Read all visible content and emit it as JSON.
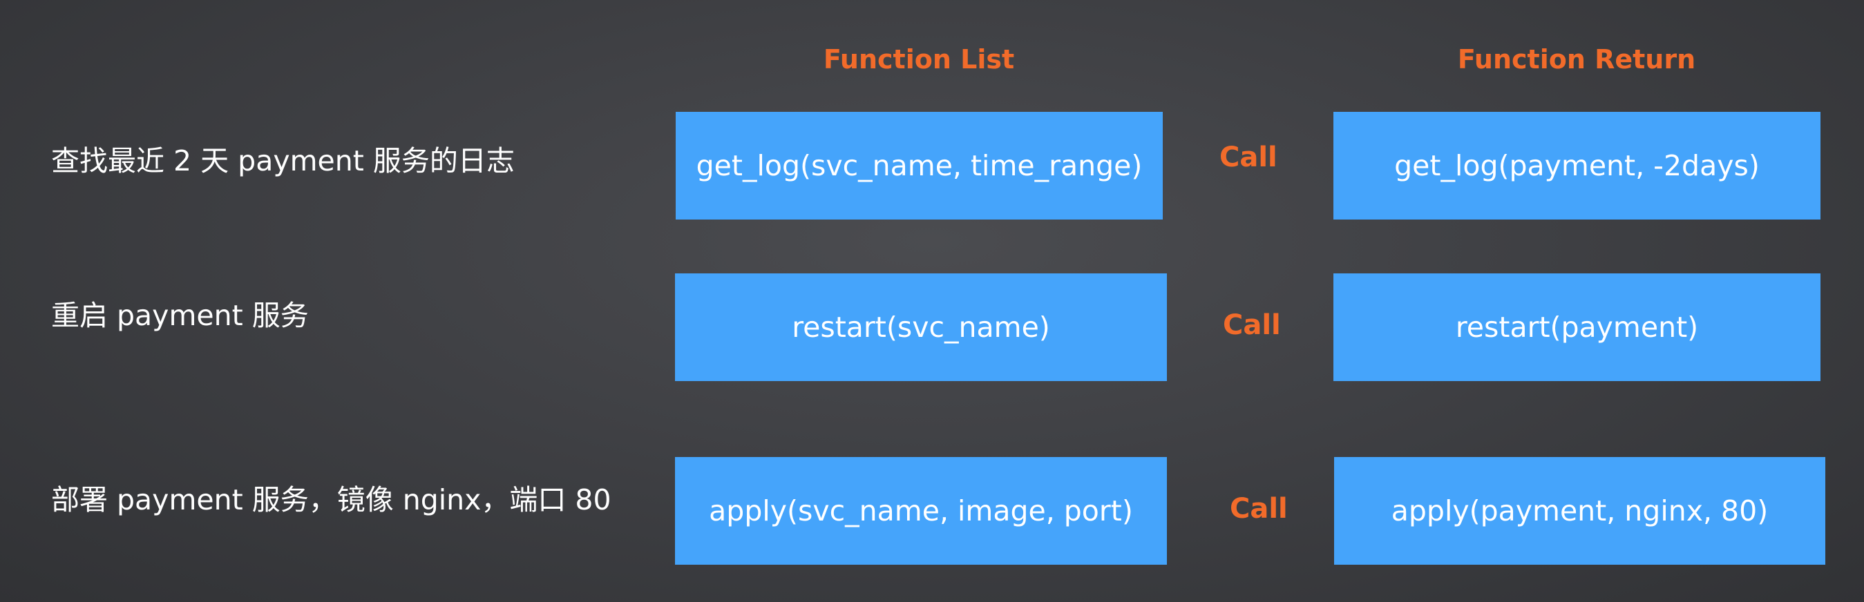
{
  "headers": {
    "function_list": "Function List",
    "function_return": "Function Return"
  },
  "rows": [
    {
      "request": "查找最近 2 天 payment 服务的日志",
      "function": "get_log(svc_name, time_range)",
      "call": "Call",
      "result": "get_log(payment, -2days)"
    },
    {
      "request": "重启 payment 服务",
      "function": "restart(svc_name)",
      "call": "Call",
      "result": "restart(payment)"
    },
    {
      "request": "部署 payment 服务，镜像 nginx，端口 80",
      "function": "apply(svc_name, image, port)",
      "call": "Call",
      "result": "apply(payment, nginx, 80)"
    }
  ],
  "colors": {
    "accent": "#f26b2a",
    "box": "#45a4fb",
    "text": "#ffffff"
  }
}
